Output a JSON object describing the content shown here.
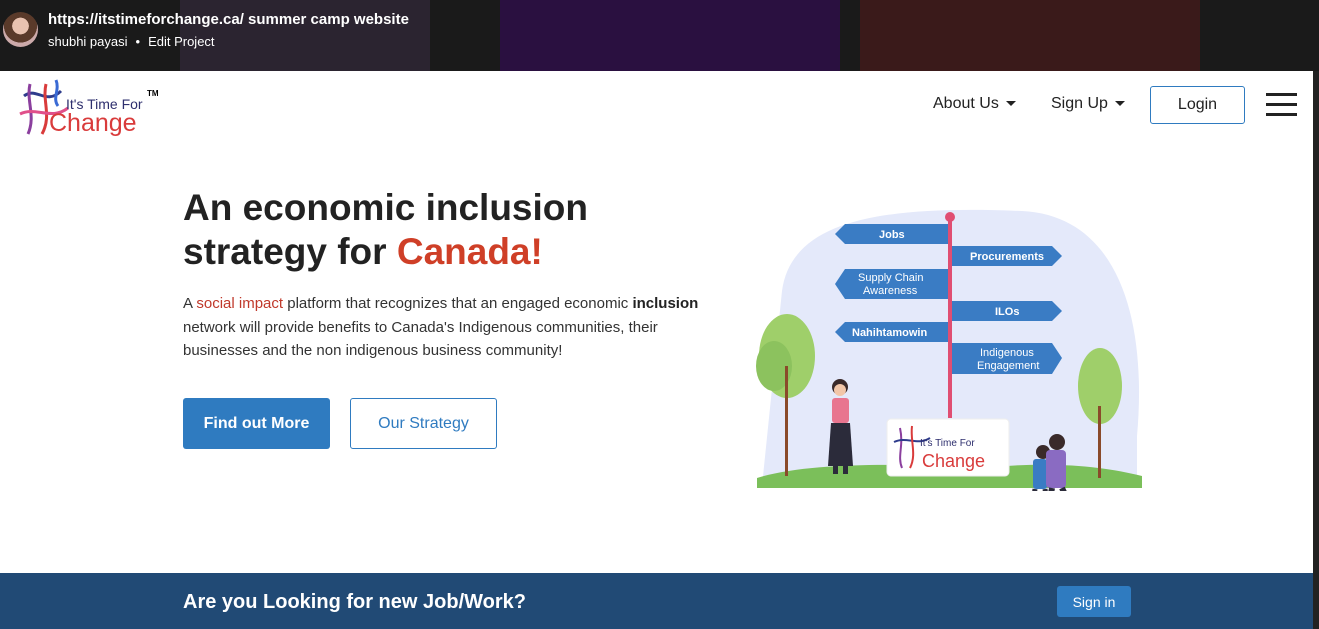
{
  "overlay": {
    "title": "https://itstimeforchange.ca/ summer camp website",
    "author": "shubhi payasi",
    "separator": "•",
    "action": "Edit Project"
  },
  "logo": {
    "line1": "It's Time For",
    "tm": "TM",
    "line2": "Change"
  },
  "nav": {
    "about": "About Us",
    "signup": "Sign Up",
    "login": "Login"
  },
  "hero": {
    "headline_part1": "An economic inclusion",
    "headline_part2": "strategy for ",
    "headline_highlight": "Canada!",
    "para_prefix": "A ",
    "para_highlight": "social impact",
    "para_middle": " platform that recognizes that an engaged economic ",
    "para_bold": "inclusion",
    "para_suffix": " network will provide benefits to Canada's Indigenous communities, their businesses and the non indigenous business community!",
    "button_primary": "Find out More",
    "button_secondary": "Our Strategy"
  },
  "illustration": {
    "signs": [
      "Jobs",
      "Procurements",
      "Supply Chain",
      "Awareness",
      "ILOs",
      "Nahihtamowin",
      "Indigenous",
      "Engagement"
    ],
    "sign_logo_line1": "It's Time For",
    "sign_logo_line2": "Change"
  },
  "banner": {
    "text": "Are you Looking for new Job/Work?",
    "button": "Sign in"
  },
  "colors": {
    "accent": "#2f7bc0",
    "highlight": "#cf3f27",
    "banner": "#214a75"
  }
}
